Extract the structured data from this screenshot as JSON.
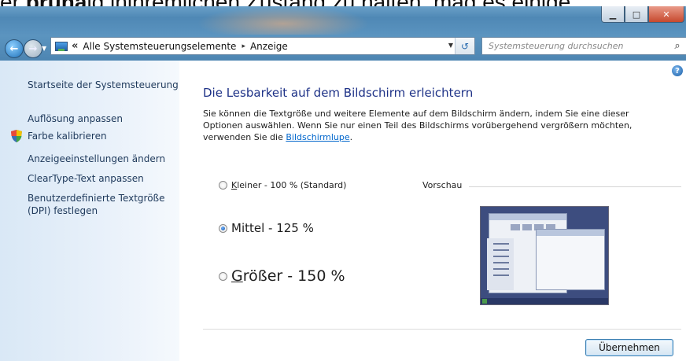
{
  "top_strip": {
    "pre": "er ",
    "bold": "pruna",
    "mid": "ig in",
    "underlined": "ihrem",
    "post": "lichen Zustand zu halten, mag es einige"
  },
  "window": {
    "minimize_symbol": "▁",
    "maximize_symbol": "□",
    "close_symbol": "✕"
  },
  "address_bar": {
    "chevron": "«",
    "segments": [
      "Alle Systemsteuerungselemente",
      "Anzeige"
    ],
    "separator": "▸"
  },
  "search": {
    "placeholder": "Systemsteuerung durchsuchen"
  },
  "sidebar": {
    "home": "Startseite der Systemsteuerung",
    "items": [
      "Auflösung anpassen",
      "Farbe kalibrieren",
      "Anzeigeeinstellungen ändern",
      "ClearType-Text anpassen",
      "Benutzerdefinierte Textgröße",
      "(DPI) festlegen"
    ]
  },
  "main": {
    "heading": "Die Lesbarkeit auf dem Bildschirm erleichtern",
    "description_line1": "Sie können die Textgröße und weitere Elemente auf dem Bildschirm ändern, indem Sie eine dieser",
    "description_line2": "Optionen auswählen. Wenn Sie nur einen Teil des Bildschirms vorübergehend vergrößern möchten,",
    "description_prefix": "verwenden Sie die ",
    "description_link": "Bildschirmlupe",
    "description_suffix": ".",
    "options": [
      {
        "hotkey": "K",
        "rest": "leiner - 100 % (Standard)",
        "selected": false
      },
      {
        "hotkey": "",
        "rest": "Mittel - 125 %",
        "selected": true
      },
      {
        "hotkey": "G",
        "rest": "rößer - 150 %",
        "selected": false
      }
    ],
    "preview_label": "Vorschau",
    "apply_button": "Übernehmen"
  }
}
